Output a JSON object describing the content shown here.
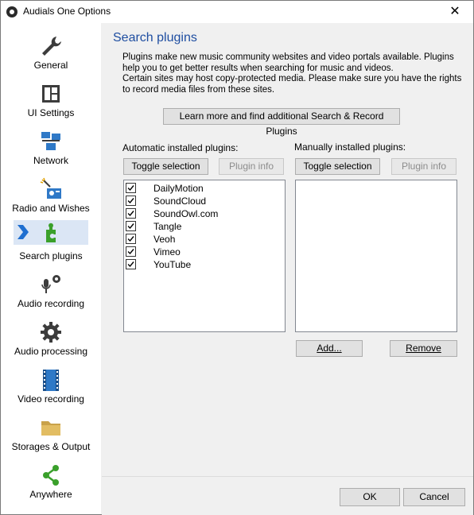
{
  "window": {
    "title": "Audials One Options"
  },
  "sidebar": {
    "items": [
      {
        "label": "General",
        "icon": "wrench-icon"
      },
      {
        "label": "UI Settings",
        "icon": "layout-icon"
      },
      {
        "label": "Network",
        "icon": "network-icon"
      },
      {
        "label": "Radio and Wishes",
        "icon": "radio-icon"
      },
      {
        "label": "Search plugins",
        "icon": "puzzle-icon",
        "selected": true
      },
      {
        "label": "Audio recording",
        "icon": "microphone-icon"
      },
      {
        "label": "Audio processing",
        "icon": "gear-icon"
      },
      {
        "label": "Video recording",
        "icon": "film-icon"
      },
      {
        "label": "Storages & Output",
        "icon": "folder-icon"
      },
      {
        "label": "Anywhere",
        "icon": "share-icon"
      }
    ]
  },
  "main": {
    "heading": "Search plugins",
    "description": [
      "Plugins make new music community websites and video portals available. Plugins help you to get better results when searching for music and videos.",
      "Certain sites may host copy-protected media. Please make sure you have the rights to record media files from these sites."
    ],
    "learn_more_label": "Learn more and find additional Search & Record Plugins",
    "auto": {
      "label": "Automatic installed plugins:",
      "toggle_label": "Toggle selection",
      "info_label": "Plugin info",
      "plugins": [
        {
          "name": "DailyMotion",
          "checked": true
        },
        {
          "name": "SoundCloud",
          "checked": true
        },
        {
          "name": "SoundOwl.com",
          "checked": true
        },
        {
          "name": "Tangle",
          "checked": true
        },
        {
          "name": "Veoh",
          "checked": true
        },
        {
          "name": "Vimeo",
          "checked": true
        },
        {
          "name": "YouTube",
          "checked": true
        }
      ]
    },
    "manual": {
      "label": "Manually installed plugins:",
      "toggle_label": "Toggle selection",
      "info_label": "Plugin info",
      "add_label": "Add...",
      "remove_label": "Remove"
    }
  },
  "footer": {
    "ok_label": "OK",
    "cancel_label": "Cancel"
  },
  "colors": {
    "accent": "#1f4ea1",
    "selection": "#dbe6f5",
    "icon_blue": "#2f79c7",
    "icon_green": "#3aa02b"
  }
}
